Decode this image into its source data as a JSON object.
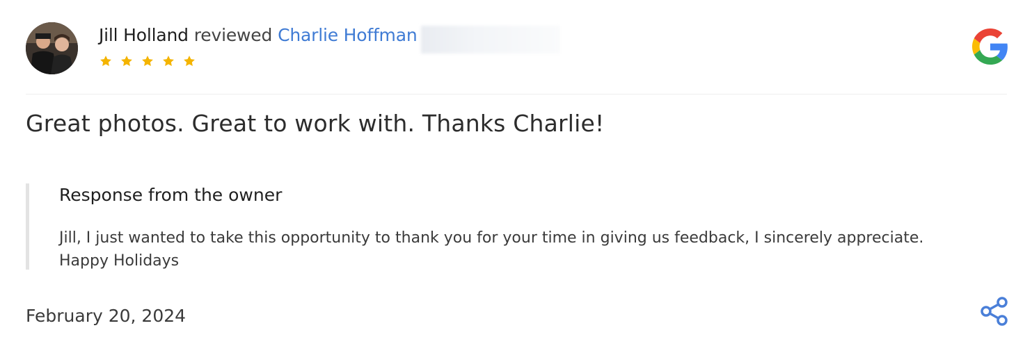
{
  "review": {
    "reviewer_name": "Jill Holland",
    "action_text": "reviewed",
    "business_name": "Charlie Hoffman",
    "rating": 5,
    "text": "Great photos. Great to work with. Thanks Charlie!",
    "date": "February 20, 2024"
  },
  "owner_response": {
    "title": "Response from the owner",
    "text": "Jill, I just wanted to take this opportunity to thank you for your time in giving us feedback, I sincerely appreciate. Happy Holidays"
  },
  "icons": {
    "source_logo": "google-logo-icon",
    "share": "share-icon",
    "star": "star-icon"
  },
  "colors": {
    "link": "#3f7bd4",
    "star": "#f4b400",
    "share": "#4a7fd8",
    "google_blue": "#4285f4",
    "google_red": "#ea4335",
    "google_yellow": "#fbbc05",
    "google_green": "#34a853"
  }
}
